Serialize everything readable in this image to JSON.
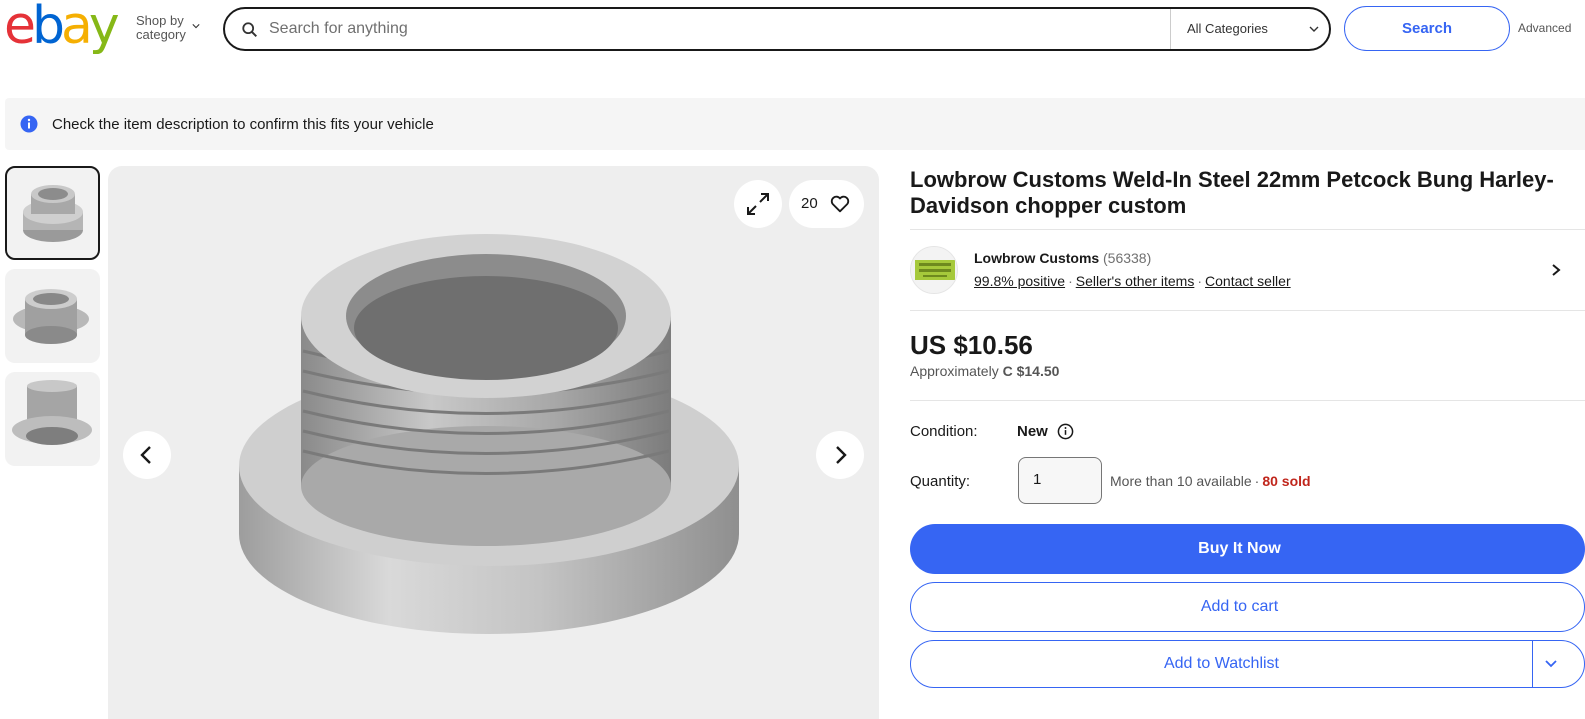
{
  "header": {
    "logo_letters": [
      "e",
      "b",
      "a",
      "y"
    ],
    "logo_colors": [
      "#e53238",
      "#0064d2",
      "#f5af02",
      "#86b817"
    ],
    "shop_by_line1": "Shop by",
    "shop_by_line2": "category",
    "search_placeholder": "Search for anything",
    "category_selected": "All Categories",
    "search_button": "Search",
    "advanced_label": "Advanced"
  },
  "notice": {
    "icon": "info-icon",
    "text": "Check the item description to confirm this fits your vehicle"
  },
  "gallery": {
    "thumbnail_count": 3,
    "active_thumbnail": 1,
    "watch_count": "20",
    "icons": [
      "expand-icon",
      "heart-icon",
      "chevron-left-icon",
      "chevron-right-icon"
    ]
  },
  "listing": {
    "title": "Lowbrow Customs Weld-In Steel 22mm Petcock Bung Harley-Davidson chopper custom",
    "seller": {
      "logo_text": "LOWBROW CUSTOMS",
      "name": "Lowbrow Customs",
      "feedback_count": "(56338)",
      "positive": "99.8% positive",
      "other_items": "Seller's other items",
      "contact": "Contact seller"
    },
    "price": "US $10.56",
    "approx_label": "Approximately",
    "approx_value": "C $14.50",
    "condition_label": "Condition:",
    "condition_value": "New",
    "quantity_label": "Quantity:",
    "quantity_value": "1",
    "available": "More than 10 available",
    "sold": "80 sold",
    "buy_now": "Buy It Now",
    "add_to_cart": "Add to cart",
    "add_to_watchlist": "Add to Watchlist"
  },
  "colors": {
    "accent": "#3665f3",
    "sold_red": "#c0261c"
  }
}
